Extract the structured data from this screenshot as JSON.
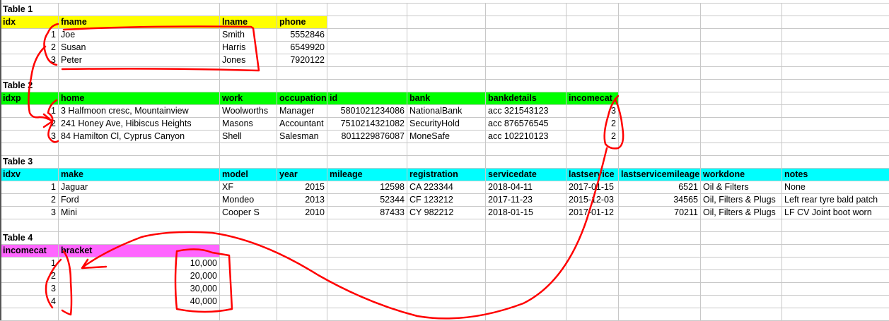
{
  "colors": {
    "table1_header": "#ffff00",
    "table2_header": "#00ff00",
    "table3_header": "#00ffff",
    "table4_header": "#ff66ff",
    "annotation": "#ff0000"
  },
  "tables": [
    {
      "title": "Table 1",
      "header_color": "#ffff00",
      "headers": [
        "idx",
        "fname",
        "lname",
        "phone"
      ],
      "rows": [
        [
          "1",
          "Joe",
          "Smith",
          "5552846"
        ],
        [
          "2",
          "Susan",
          "Harris",
          "6549920"
        ],
        [
          "3",
          "Peter",
          "Jones",
          "7920122"
        ]
      ]
    },
    {
      "title": "Table 2",
      "header_color": "#00ff00",
      "headers": [
        "idxp",
        "home",
        "work",
        "occupation",
        "id",
        "bank",
        "bankdetails",
        "incomecat"
      ],
      "rows": [
        [
          "1",
          "3 Halfmoon cresc, Mountainview",
          "Woolworths",
          "Manager",
          "5801021234086",
          "NationalBank",
          "acc 321543123",
          "3"
        ],
        [
          "2",
          "241 Honey Ave, Hibiscus Heights",
          "Masons",
          "Accountant",
          "7510214321082",
          "SecurityHold",
          "acc 876576545",
          "2"
        ],
        [
          "3",
          "84 Hamilton Cl, Cyprus Canyon",
          "Shell",
          "Salesman",
          "8011229876087",
          "MoneSafe",
          "acc 102210123",
          "2"
        ]
      ]
    },
    {
      "title": "Table 3",
      "header_color": "#00ffff",
      "headers": [
        "idxv",
        "make",
        "model",
        "year",
        "mileage",
        "registration",
        "servicedate",
        "lastservice",
        "lastservicemileage",
        "workdone",
        "notes"
      ],
      "rows": [
        [
          "1",
          "Jaguar",
          "XF",
          "2015",
          "12598",
          "CA 223344",
          "2018-04-11",
          "2017-01-15",
          "6521",
          "Oil & Filters",
          "None"
        ],
        [
          "2",
          "Ford",
          "Mondeo",
          "2013",
          "52344",
          "CF 123212",
          "2017-11-23",
          "2015-12-03",
          "34565",
          "Oil, Filters & Plugs",
          "Left rear tyre bald patch"
        ],
        [
          "3",
          "Mini",
          "Cooper S",
          "2010",
          "87433",
          "CY 982212",
          "2018-01-15",
          "2017-01-12",
          "70211",
          "Oil, Filters & Plugs",
          "LF CV Joint boot worn"
        ]
      ]
    },
    {
      "title": "Table 4",
      "header_color": "#ff66ff",
      "headers": [
        "incomecat",
        "bracket"
      ],
      "rows": [
        [
          "1",
          "10,000"
        ],
        [
          "2",
          "20,000"
        ],
        [
          "3",
          "30,000"
        ],
        [
          "4",
          "40,000"
        ]
      ]
    }
  ]
}
